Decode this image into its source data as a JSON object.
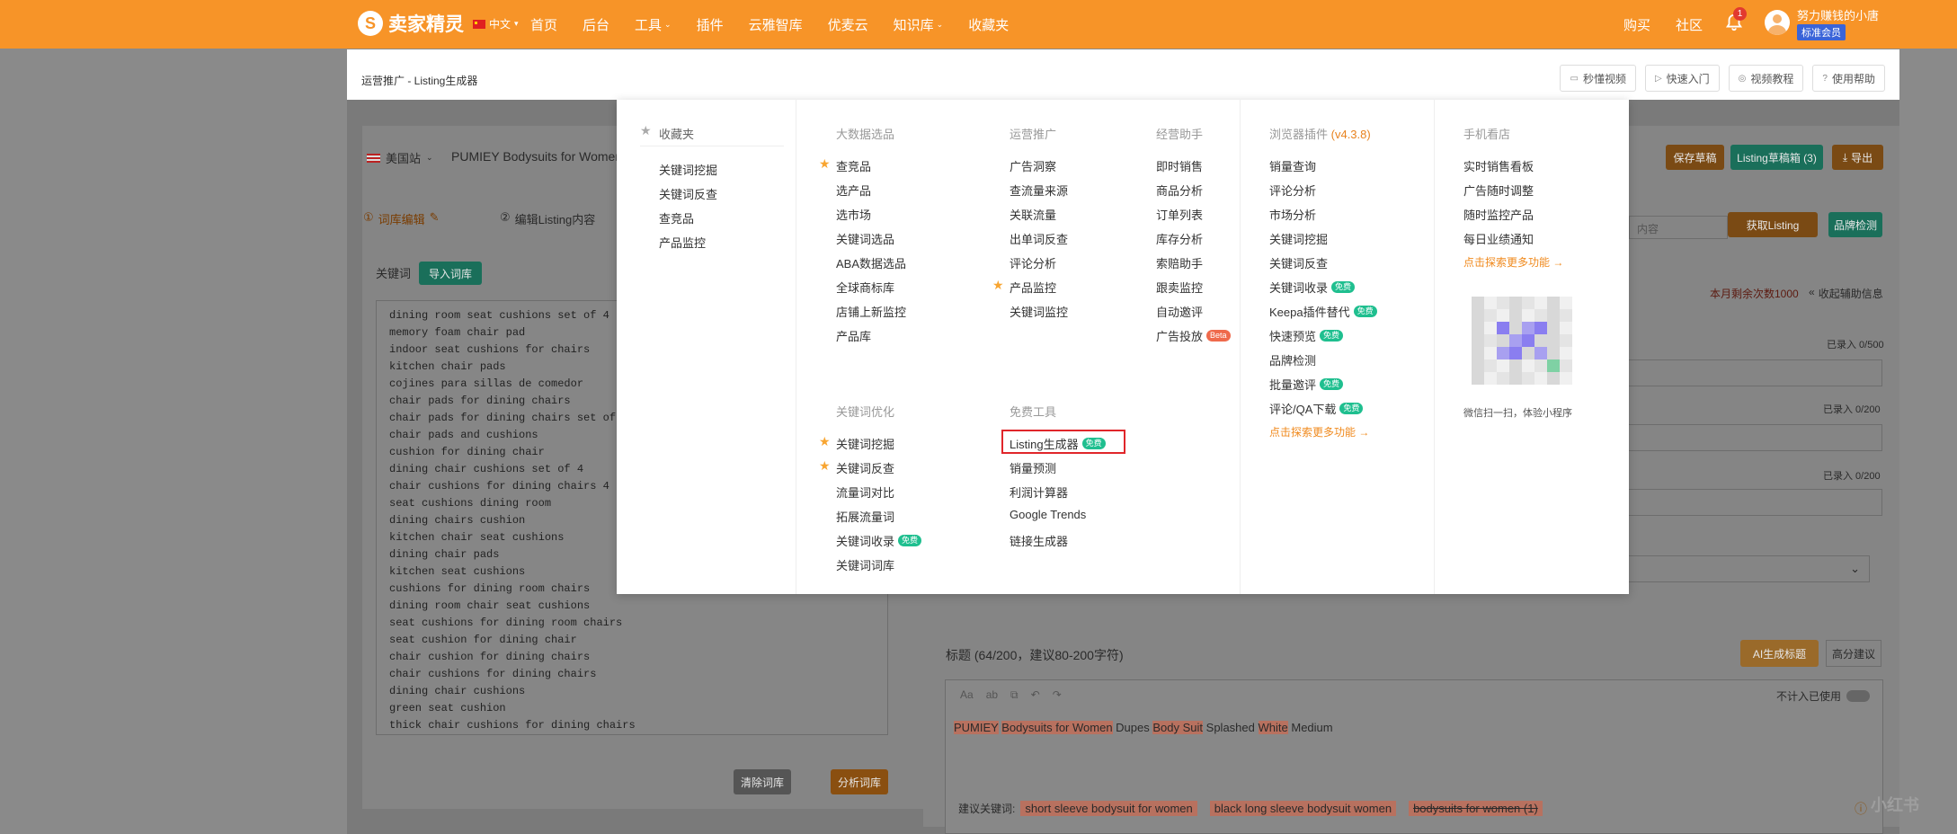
{
  "header": {
    "brand": "卖家精灵",
    "lang": "中文",
    "nav": [
      "首页",
      "后台",
      "工具",
      "插件",
      "云雅智库",
      "优麦云",
      "知识库",
      "收藏夹"
    ],
    "right_links": [
      "购买",
      "社区"
    ],
    "notif_count": "1",
    "username": "努力赚钱的小唐",
    "membership": "标准会员",
    "accent_color": "#f79428"
  },
  "subheader": {
    "breadcrumb": "运营推广 - Listing生成器",
    "buttons": [
      "秒懂视频",
      "快速入门",
      "视频教程",
      "使用帮助"
    ]
  },
  "background": {
    "site": "美国站",
    "product_title": "PUMIEY Bodysuits for Women",
    "step1": "词库编辑",
    "step2": "编辑Listing内容",
    "keyword_label": "关键词",
    "import_btn": "导入词库",
    "keywords": [
      "dining room seat cushions set of 4",
      "memory foam chair pad",
      "indoor seat cushions for chairs",
      "kitchen chair pads",
      "cojines para sillas de comedor",
      "chair pads for dining chairs",
      "chair pads for dining chairs set of",
      "chair pads and cushions",
      "cushion for dining chair",
      "dining chair cushions set of 4",
      "chair cushions for dining chairs 4 p",
      "seat cushions dining room",
      "dining chairs cushion",
      "kitchen chair seat cushions",
      "dining chair pads",
      "kitchen seat cushions",
      "cushions for dining room chairs",
      "dining room chair seat cushions",
      "seat cushions for dining room chairs",
      "seat cushion for dining chair",
      "chair cushion for dining chairs",
      "chair cushions for dining chairs",
      "dining chair cushions",
      "green seat cushion",
      "thick chair cushions for dining chairs"
    ],
    "clear_btn": "清除词库",
    "analyze_btn": "分析词库",
    "save_draft": "保存草稿",
    "listing_draft": "Listing草稿箱 (3)",
    "export": "导出",
    "asin_placeholder": "内容",
    "get_listing": "获取Listing",
    "brand_check": "品牌检测",
    "remaining": "本月剩余次数1000",
    "collapse_info": "收起辅助信息",
    "entered_1": "已录入 0/500",
    "entered_2": "已录入 0/200",
    "entered_3": "已录入 0/200",
    "title_label": "标题 (64/200，建议80-200字符)",
    "ai_btn": "AI生成标题",
    "advanced": "高分建议",
    "not_counted": "不计入已使用",
    "title_words": [
      "PUMIEY",
      "Bodysuits for Women",
      "Dupes",
      "Body Suit",
      "Splashed",
      "White",
      "Medium"
    ],
    "suggest_label": "建议关键词:",
    "suggest_tags": [
      "short sleeve bodysuit for women",
      "black long sleeve bodysuit women",
      "bodysuits for women (1)"
    ]
  },
  "menu": {
    "favorites": {
      "title": "收藏夹",
      "items": [
        "关键词挖掘",
        "关键词反查",
        "查竞品",
        "产品监控"
      ]
    },
    "bigdata": {
      "title": "大数据选品",
      "items": [
        "查竞品",
        "选产品",
        "选市场",
        "关键词选品",
        "ABA数据选品",
        "全球商标库",
        "店铺上新监控",
        "产品库"
      ]
    },
    "operation": {
      "title": "运营推广",
      "items": [
        "广告洞察",
        "查流量来源",
        "关联流量",
        "出单词反查",
        "评论分析",
        "产品监控",
        "关键词监控"
      ]
    },
    "business": {
      "title": "经营助手",
      "items": [
        "即时销售",
        "商品分析",
        "订单列表",
        "库存分析",
        "索赔助手",
        "跟卖监控",
        "自动邀评",
        "广告投放"
      ],
      "hot_label": "Beta"
    },
    "keyword_opt": {
      "title": "关键词优化",
      "items": [
        "关键词挖掘",
        "关键词反查",
        "流量词对比",
        "拓展流量词",
        "关键词收录",
        "关键词词库"
      ]
    },
    "free_tools": {
      "title": "免费工具",
      "items": [
        "Listing生成器",
        "销量预测",
        "利润计算器",
        "Google Trends",
        "链接生成器"
      ]
    },
    "browser_plugin": {
      "title": "浏览器插件",
      "version": "(v4.3.8)",
      "items": [
        "销量查询",
        "评论分析",
        "市场分析",
        "关键词挖掘",
        "关键词反查",
        "关键词收录",
        "Keepa插件替代",
        "快速预览",
        "品牌检测",
        "批量邀评",
        "评论/QA下载"
      ],
      "more": "点击探索更多功能 →"
    },
    "mobile": {
      "title": "手机看店",
      "items": [
        "实时销售看板",
        "广告随时调整",
        "随时监控产品",
        "每日业绩通知"
      ],
      "more": "点击探索更多功能 →",
      "qr_caption": "微信扫一扫，体验小程序"
    },
    "free_label": "免费"
  },
  "watermark": "小红书"
}
